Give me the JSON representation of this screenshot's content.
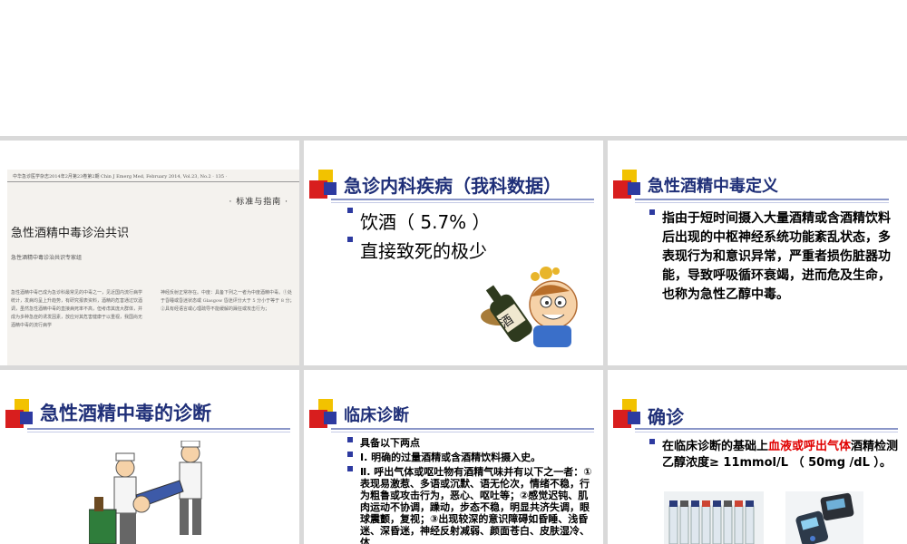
{
  "slides": {
    "paper": {
      "header": "中华急诊医学杂志2014年2月第23卷第2期 Chin J Emerg Med, February 2014, Vol.23, No.2 · 135 ·",
      "guide_label": "· 标准与指南 ·",
      "paper_title": "急性酒精中毒诊治共识",
      "authors": "急性酒精中毒诊治共识专家组",
      "col1": "急性酒精中毒已成为急诊科最常见的中毒之一，见近国内流行病学统计，发病均呈上升趋势，有研究报表资料，酒精的危害通过饮酒调，虽然急性酒精中毒的直接病死率不高，但考虑其庞大群体，并成为多种急症的诱发因素，放应对其危害健康于以重视，我国尚无酒精中毒的流行病学",
      "col2": "神经反射正常存在。中度：具备下列之一者为中度酒精中毒。①处于昏睡或昏迷状态或 Glasgow 昏迷评分大于 5 分小于等于 8 分；②具有经语言或心理疏导不能缓解的躁狂或攻击行为；"
    },
    "data": {
      "title": "急诊内科疾病（我科数据）",
      "bullets": [
        "饮酒（ 5.7% ）",
        "直接致死的极少"
      ],
      "bottle_label": "酒"
    },
    "definition": {
      "title": "急性酒精中毒定义",
      "text": "指由于短时间摄入大量酒精或含酒精饮料后出现的中枢神经系统功能紊乱状态，多表现行为和意识异常，严重者损伤脏器功能，导致呼吸循环衰竭，进而危及生命，也称为急性乙醇中毒。"
    },
    "diagnosis": {
      "title": "急性酒精中毒的诊断"
    },
    "clinical": {
      "title": "临床诊断",
      "intro": "具备以下两点",
      "item1": "Ⅰ. 明确的过量酒精或含酒精饮料摄入史。",
      "item2": "Ⅱ. 呼出气体或呕吐物有酒精气味并有以下之一者：①表现易激惹、多语或沉默、语无伦次，情绪不稳，行为粗鲁或攻击行为，恶心、呕吐等；②感觉迟钝、肌肉运动不协调，躁动，步态不稳，明显共济失调，眼球震颤，复视；③出现较深的意识障碍如昏睡、浅昏迷、深昏迷，神经反射减弱、颜面苍白、皮肤湿冷、体"
    },
    "confirm": {
      "title": "确诊",
      "text_before": "在临床诊断的基础上",
      "text_red": "血液或呼出气体",
      "text_after": "酒精检测乙醇浓度≥ 11mmol/L （ 50mg /dL ）。"
    }
  },
  "colors": {
    "title": "#1f2f78",
    "accent_red": "#e00000",
    "deco_yellow": "#f2c200",
    "deco_red": "#d81e1e",
    "deco_blue": "#2d3aa0",
    "gap_gray": "#d9d9d9"
  }
}
